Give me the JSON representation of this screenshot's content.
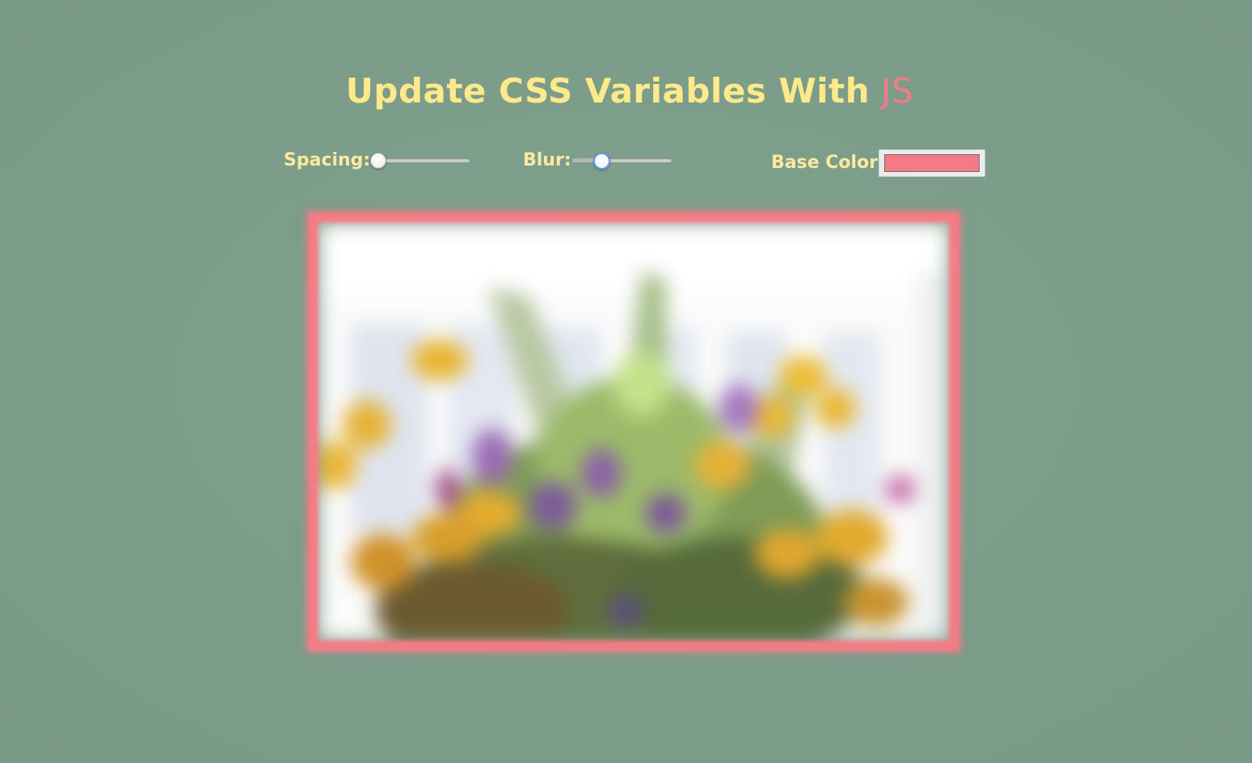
{
  "title": {
    "main": "Update CSS Variables With",
    "highlight": "JS"
  },
  "controls": {
    "spacing": {
      "label": "Spacing:",
      "value": 0,
      "fraction": 0.0
    },
    "blur": {
      "label": "Blur:",
      "value": 5,
      "fraction": 0.25
    },
    "base_color": {
      "label": "Base Color:",
      "value": "#f47b86"
    }
  },
  "colors": {
    "background": "#7d9f8b",
    "title": "#ffe98a",
    "accent": "#f47b86"
  },
  "image": {
    "subject": "blurred bouquet of yellow and purple wildflowers in front of a white window"
  }
}
